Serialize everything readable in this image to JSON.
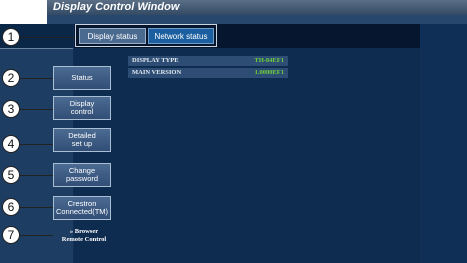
{
  "window": {
    "title": "Display Control Window"
  },
  "tabs": [
    {
      "label": "Display status"
    },
    {
      "label": "Network status"
    }
  ],
  "sidebar": {
    "buttons": [
      {
        "label": "Status"
      },
      {
        "label": "Display\ncontrol"
      },
      {
        "label": "Detailed\nset up"
      },
      {
        "label": "Change\npassword"
      },
      {
        "label": "Crestron\nConnected(TM)"
      }
    ],
    "remote_link": "» Browser\nRemote Control"
  },
  "info": [
    {
      "label": "DISPLAY TYPE",
      "value": "TH-84EF1"
    },
    {
      "label": "MAIN VERSION",
      "value": "1.0000EF1"
    }
  ],
  "callouts": [
    "1",
    "2",
    "3",
    "4",
    "5",
    "6",
    "7"
  ]
}
